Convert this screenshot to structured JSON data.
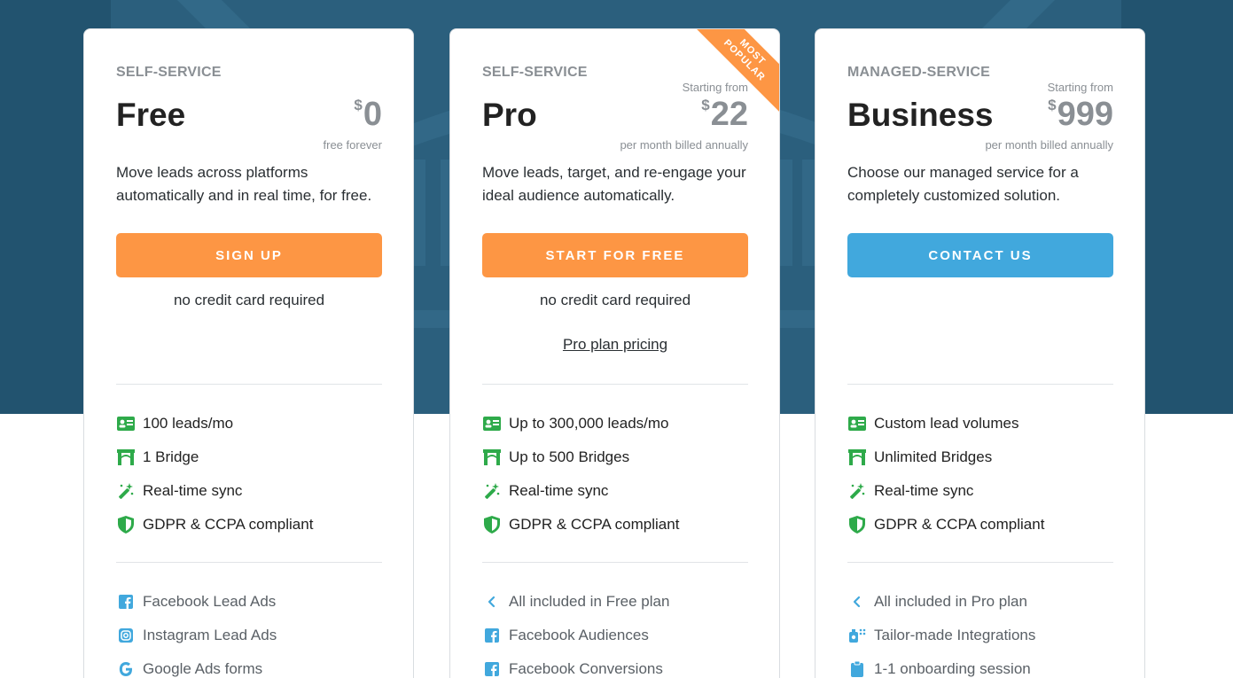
{
  "plans": [
    {
      "tier": "SELF-SERVICE",
      "name": "Free",
      "starting_from": "",
      "currency": "$",
      "price": "0",
      "billing": "free forever",
      "description": "Move leads across platforms automatically and in real time, for free.",
      "cta": "SIGN UP",
      "note": "no credit card required",
      "features": [
        {
          "icon": "lead-card-icon",
          "label": "100 leads/mo"
        },
        {
          "icon": "bridge-icon",
          "label": "1 Bridge"
        },
        {
          "icon": "magic-wand-icon",
          "label": "Real-time sync"
        },
        {
          "icon": "shield-icon",
          "label": "GDPR & CCPA compliant"
        }
      ],
      "integrations": [
        {
          "icon": "facebook-icon",
          "label": "Facebook Lead Ads"
        },
        {
          "icon": "instagram-icon",
          "label": "Instagram Lead Ads"
        },
        {
          "icon": "google-icon",
          "label": "Google Ads forms"
        }
      ]
    },
    {
      "tier": "SELF-SERVICE",
      "name": "Pro",
      "starting_from": "Starting from",
      "currency": "$",
      "price": "22",
      "billing": "per month billed annually",
      "ribbon": [
        "MOST",
        "POPULAR"
      ],
      "description": "Move leads, target, and re-engage your ideal audience automatically.",
      "cta": "START FOR FREE",
      "note": "no credit card required",
      "link": "Pro plan pricing",
      "features": [
        {
          "icon": "lead-card-icon",
          "label": "Up to 300,000 leads/mo"
        },
        {
          "icon": "bridge-icon",
          "label": "Up to 500 Bridges"
        },
        {
          "icon": "magic-wand-icon",
          "label": "Real-time sync"
        },
        {
          "icon": "shield-icon",
          "label": "GDPR & CCPA compliant"
        }
      ],
      "integrations": [
        {
          "icon": "chevron-left-icon",
          "label": "All included in Free plan"
        },
        {
          "icon": "facebook-icon",
          "label": "Facebook Audiences"
        },
        {
          "icon": "facebook-icon",
          "label": "Facebook Conversions"
        }
      ]
    },
    {
      "tier": "MANAGED-SERVICE",
      "name": "Business",
      "starting_from": "Starting from",
      "currency": "$",
      "price": "999",
      "billing": "per month billed annually",
      "description": "Choose our managed service for a completely customized solution.",
      "cta": "CONTACT US",
      "features": [
        {
          "icon": "lead-card-icon",
          "label": "Custom lead volumes"
        },
        {
          "icon": "bridge-icon",
          "label": "Unlimited Bridges"
        },
        {
          "icon": "magic-wand-icon",
          "label": "Real-time sync"
        },
        {
          "icon": "shield-icon",
          "label": "GDPR & CCPA compliant"
        }
      ],
      "integrations": [
        {
          "icon": "chevron-left-icon",
          "label": "All included in Pro plan"
        },
        {
          "icon": "integrations-icon",
          "label": "Tailor-made Integrations"
        },
        {
          "icon": "clipboard-icon",
          "label": "1-1 onboarding session"
        }
      ]
    }
  ],
  "colors": {
    "hero": "#22536f",
    "orange": "#fd9644",
    "blue": "#41a8dd",
    "green": "#2eaa4a",
    "icon_blue": "#41a8dd"
  }
}
